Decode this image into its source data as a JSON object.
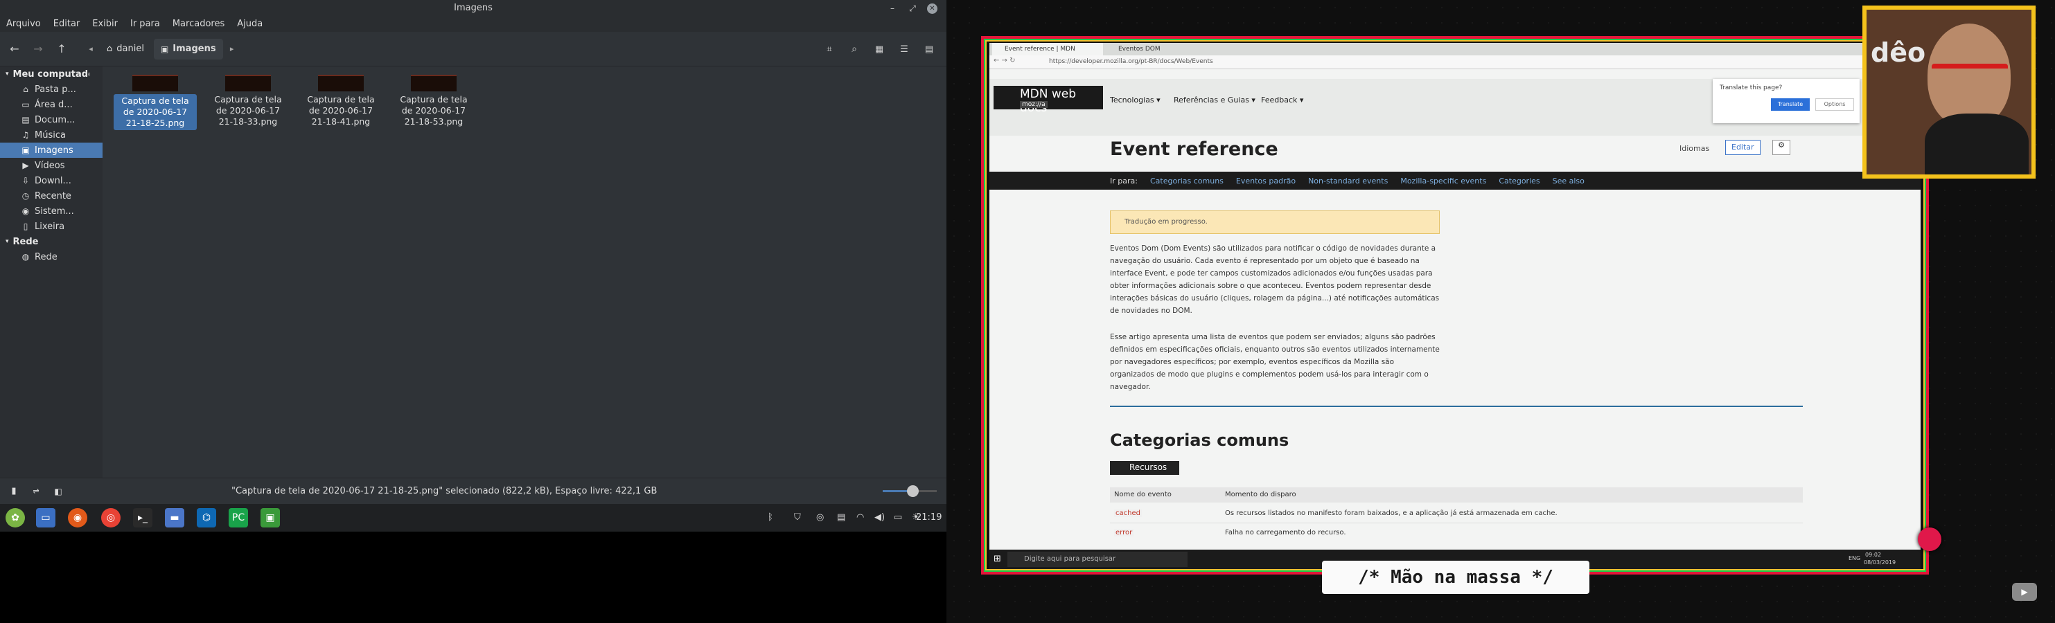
{
  "file_manager": {
    "title": "Imagens",
    "menu": [
      "Arquivo",
      "Editar",
      "Exibir",
      "Ir para",
      "Marcadores",
      "Ajuda"
    ],
    "breadcrumbs": [
      "daniel",
      "Imagens"
    ],
    "sidebar": {
      "section1": "Meu computador",
      "items": [
        {
          "label": "Pasta p...",
          "icon": "home-icon"
        },
        {
          "label": "Área d...",
          "icon": "desktop-icon"
        },
        {
          "label": "Docum...",
          "icon": "document-icon"
        },
        {
          "label": "Música",
          "icon": "music-icon"
        },
        {
          "label": "Imagens",
          "icon": "image-icon",
          "selected": true
        },
        {
          "label": "Vídeos",
          "icon": "video-icon"
        },
        {
          "label": "Downl...",
          "icon": "download-icon"
        },
        {
          "label": "Recente",
          "icon": "clock-icon"
        },
        {
          "label": "Sistem...",
          "icon": "drive-icon"
        },
        {
          "label": "Lixeira",
          "icon": "trash-icon"
        }
      ],
      "section2": "Rede",
      "network_items": [
        {
          "label": "Rede",
          "icon": "network-icon"
        }
      ]
    },
    "files": [
      {
        "line1": "Captura de tela",
        "line2": "de 2020-06-17",
        "line3": "21-18-25.png",
        "selected": true
      },
      {
        "line1": "Captura de tela",
        "line2": "de 2020-06-17",
        "line3": "21-18-33.png",
        "selected": false
      },
      {
        "line1": "Captura de tela",
        "line2": "de 2020-06-17",
        "line3": "21-18-41.png",
        "selected": false
      },
      {
        "line1": "Captura de tela",
        "line2": "de 2020-06-17",
        "line3": "21-18-53.png",
        "selected": false
      }
    ],
    "status": "\"Captura de tela de 2020-06-17 21-18-25.png\" selecionado (822,2 kB), Espaço livre: 422,1 GB",
    "zoom_level": 0.55
  },
  "taskbar": {
    "clock": "21:19"
  },
  "browser": {
    "tabs": [
      "Event reference | MDN",
      "Eventos DOM"
    ],
    "url": "https://developer.mozilla.org/pt-BR/docs/Web/Events",
    "logo": "MDN web docs",
    "logo_sub": "moz://a",
    "nav": [
      "Tecnologias ▾",
      "Referências e Guias ▾",
      "Feedback ▾"
    ],
    "heading": "Event reference",
    "langs": "Idiomas",
    "edit": "Editar",
    "translate_prompt": "Translate this page?",
    "translate_btn": "Translate",
    "options_btn": "Options",
    "jump_label": "Ir para:",
    "jump_links": [
      "Categorias comuns",
      "Eventos padrão",
      "Non-standard events",
      "Mozilla-specific events",
      "Categories",
      "See also"
    ],
    "notice": "Tradução em progresso.",
    "para1": "Eventos Dom (Dom Events) são utilizados para notificar o código de novidades durante a navegação do usuário. Cada evento é representado por um objeto que é baseado na interface Event, e pode ter campos customizados adicionados e/ou funções usadas para obter informações adicionais sobre o que aconteceu. Eventos podem representar desde interações básicas do usuário (cliques, rolagem da página...) até notificações automáticas de novidades no DOM.",
    "para2": "Esse artigo apresenta uma lista de eventos que podem ser enviados; alguns são padrões definidos em especificações oficiais, enquanto outros são eventos utilizados internamente por navegadores específicos; por exemplo, eventos específicos da Mozilla são organizados de modo que plugins e complementos podem usá-los para interagir com o navegador.",
    "section_title": "Categorias comuns",
    "sub_badge": "Recursos",
    "table_headers": [
      "Nome do evento",
      "Momento do disparo"
    ],
    "table_rows": [
      [
        "cached",
        "Os recursos listados no manifesto foram baixados, e a aplicação já está armazenada em cache."
      ],
      [
        "error",
        "Falha no carregamento do recurso."
      ]
    ],
    "win_search": "Digite aqui para pesquisar",
    "win_lang": "ENG",
    "win_time": "09:02",
    "win_date": "08/03/2019"
  },
  "cam_text": "dêo",
  "banner": "/* Mão na massa */"
}
